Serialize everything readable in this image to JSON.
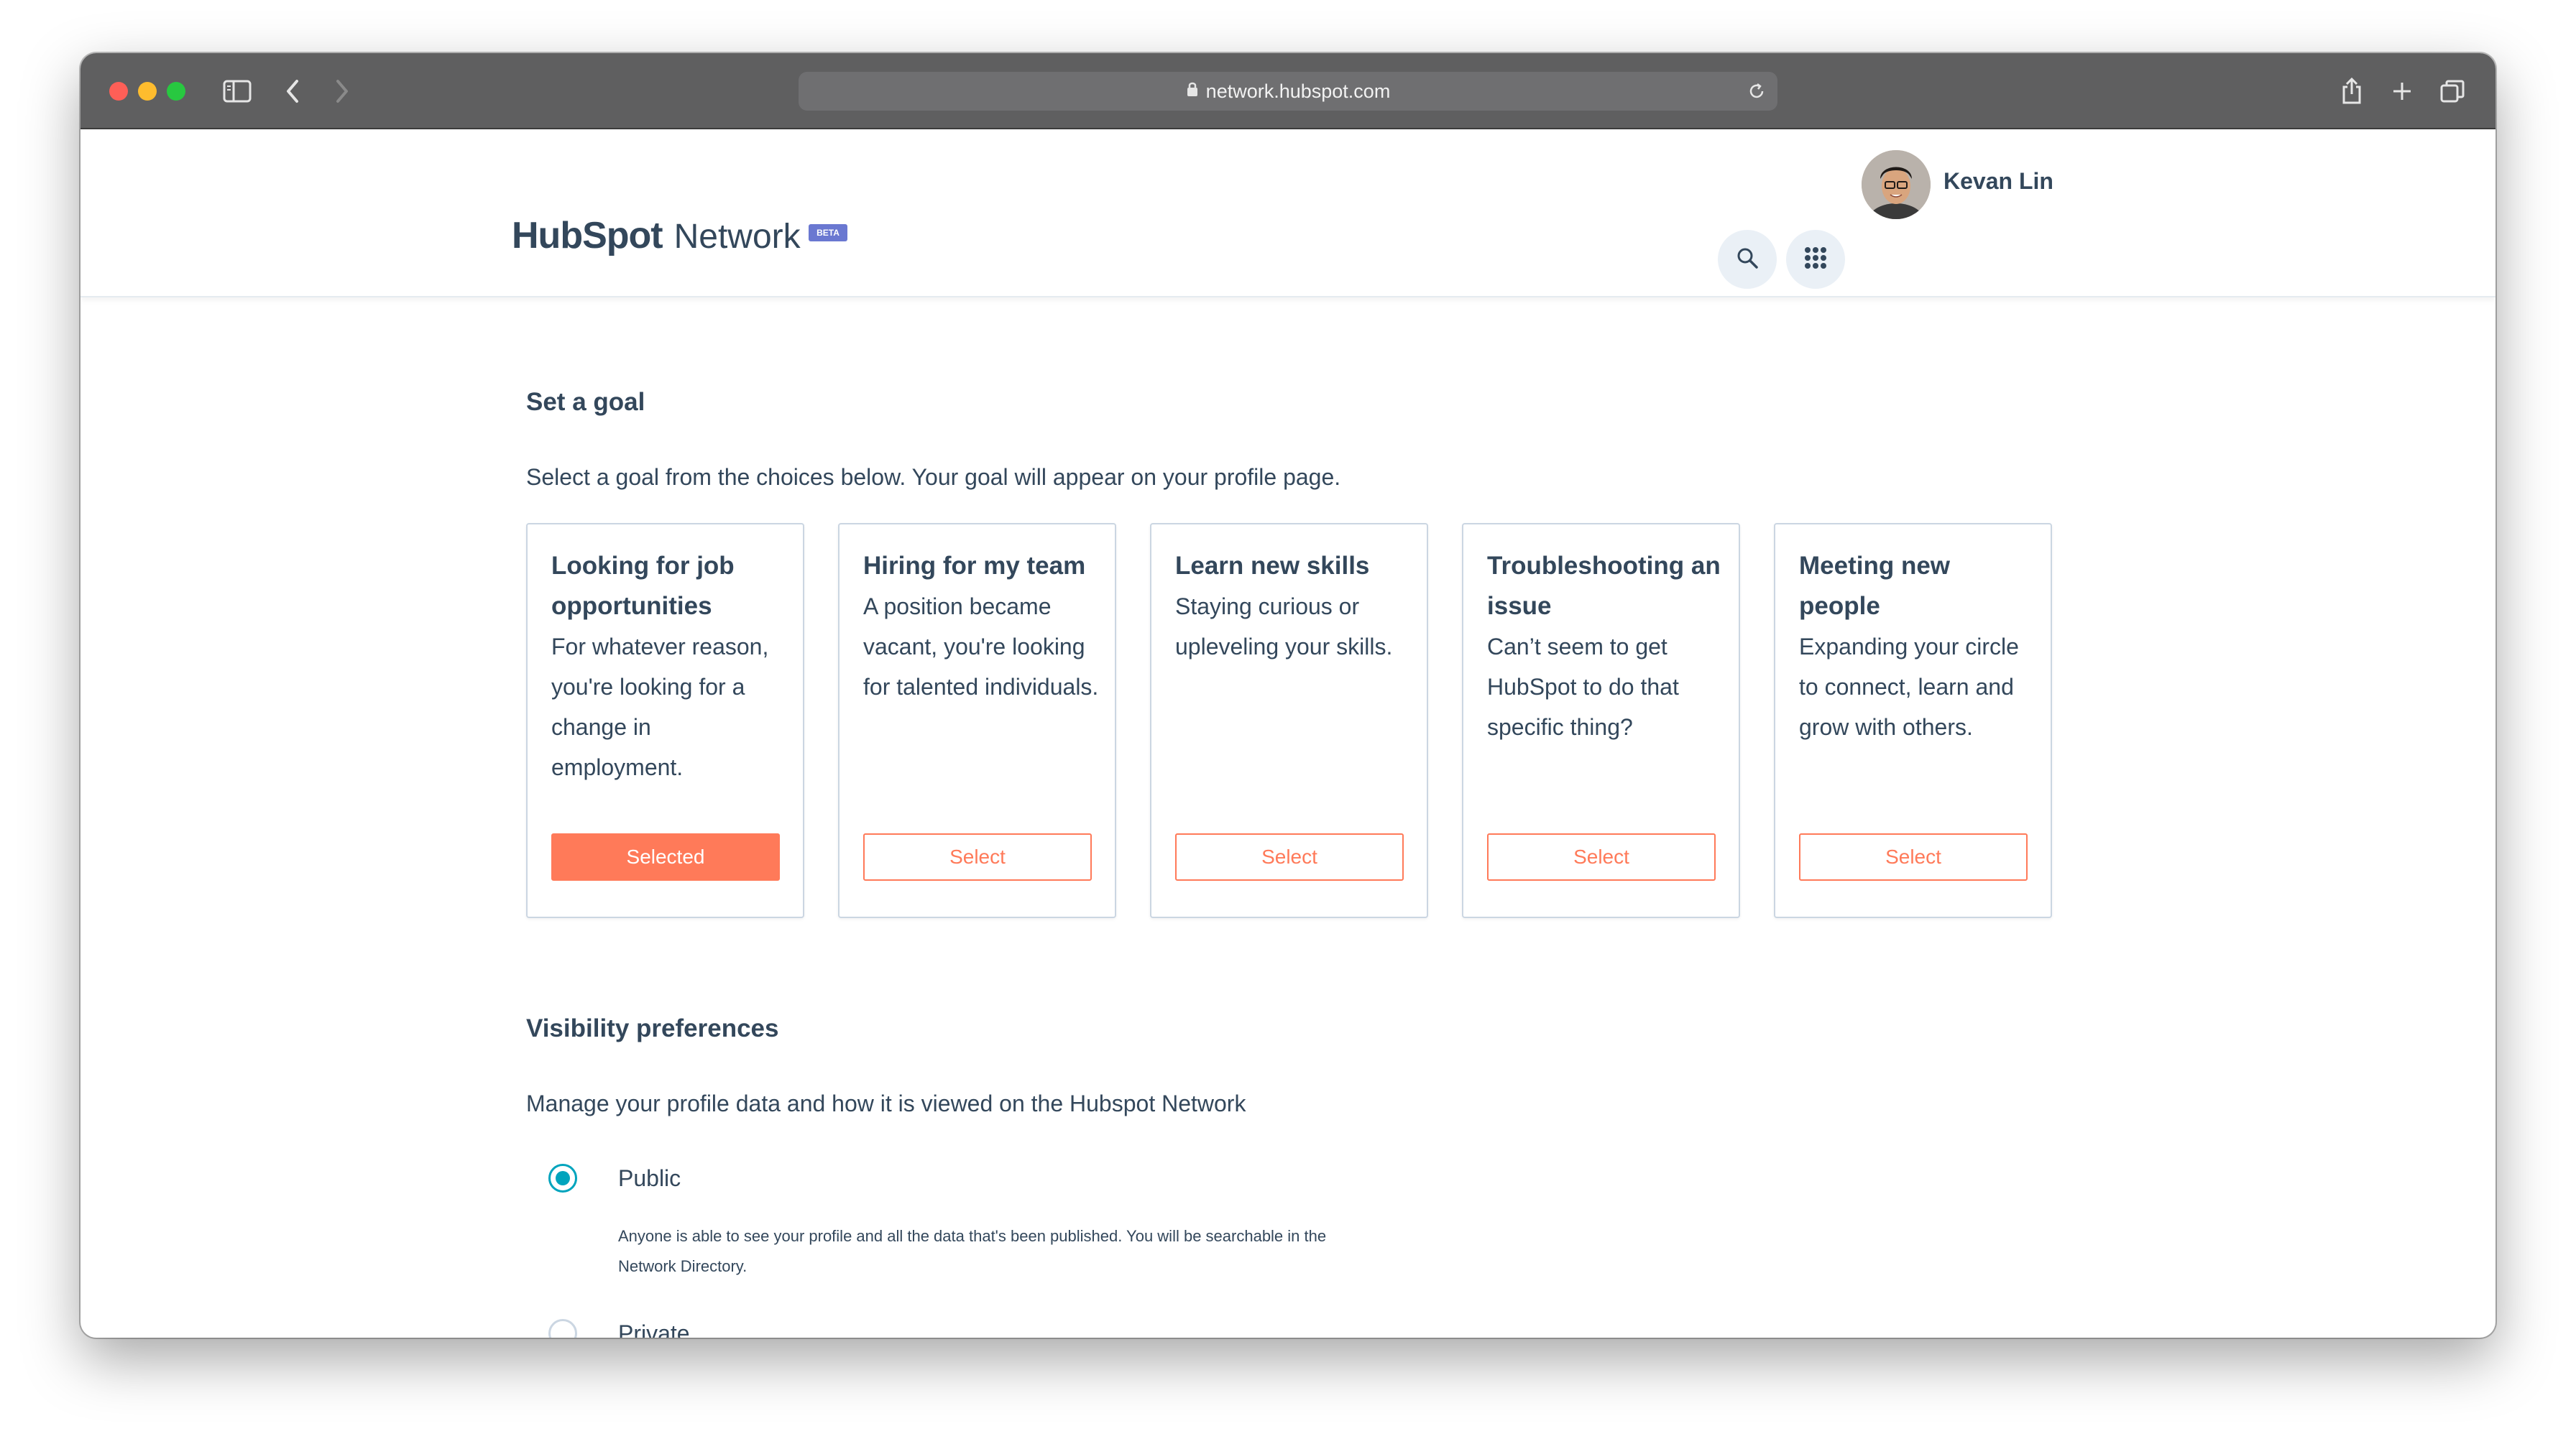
{
  "browser": {
    "url": "network.hubspot.com"
  },
  "header": {
    "logo_text": "HubSpot",
    "logo_suffix": "Network",
    "beta_badge": "BETA",
    "user_name": "Kevan Lin"
  },
  "goal_section": {
    "title": "Set a goal",
    "description": "Select a goal from the choices below. Your goal will appear on your profile page.",
    "cards": [
      {
        "title": "Looking for job opportunities",
        "description": "For whatever reason, you're looking for a change in employment.",
        "button": "Selected",
        "selected": true
      },
      {
        "title": "Hiring for my team",
        "description": "A position became vacant, you're looking for talented individuals.",
        "button": "Select",
        "selected": false
      },
      {
        "title": "Learn new skills",
        "description": "Staying curious or upleveling your skills.",
        "button": "Select",
        "selected": false
      },
      {
        "title": "Troubleshooting an issue",
        "description": "Can’t seem to get HubSpot to do that specific thing?",
        "button": "Select",
        "selected": false
      },
      {
        "title": "Meeting new people",
        "description": "Expanding your circle to connect, learn and grow with others.",
        "button": "Select",
        "selected": false
      }
    ]
  },
  "visibility_section": {
    "title": "Visibility preferences",
    "description": "Manage your profile data and how it is viewed on the Hubspot Network",
    "options": [
      {
        "label": "Public",
        "help": "Anyone is able to see your profile and all the data that's been published. You will be searchable in the Network Directory.",
        "checked": true
      },
      {
        "label": "Private",
        "checked": false
      }
    ]
  },
  "colors": {
    "accent": "#ff7a59",
    "radio_checked": "#00a4bd",
    "text": "#33475b",
    "toolbar": "#5f5f60"
  }
}
